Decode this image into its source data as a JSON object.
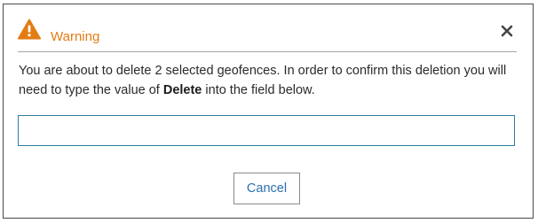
{
  "dialog": {
    "title": "Warning",
    "icons": {
      "header": "warning-triangle-icon",
      "close": "close-icon"
    },
    "message": {
      "before": "You are about to delete 2 selected geofences. In order to confirm this deletion you will need to type the value of ",
      "keyword": "Delete",
      "after": " into the field below."
    },
    "input": {
      "value": "",
      "placeholder": ""
    },
    "buttons": {
      "cancel_label": "Cancel"
    },
    "colors": {
      "accent": "#e37c13",
      "input_border": "#2e7d9e",
      "button_text": "#2a6fb0"
    }
  }
}
